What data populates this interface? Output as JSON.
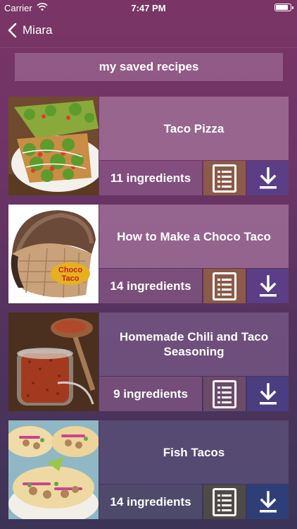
{
  "status_bar": {
    "carrier": "Carrier",
    "time": "7:47 PM"
  },
  "nav": {
    "back_label": "Miara"
  },
  "header": {
    "title": "my saved recipes"
  },
  "recipes": [
    {
      "title": "Taco Pizza",
      "ingredients": "11 ingredients"
    },
    {
      "title": "How to Make a Choco Taco",
      "ingredients": "14 ingredients"
    },
    {
      "title": "Homemade Chili and Taco Seasoning",
      "ingredients": "9 ingredients"
    },
    {
      "title": "Fish Tacos",
      "ingredients": "14 ingredients"
    }
  ],
  "thumb_text": {
    "choco_logo_line1": "Choco",
    "choco_logo_line2": "Taco"
  },
  "colors": {
    "accent_purple": "#5b3e85",
    "card_pink": "#a5769e"
  }
}
